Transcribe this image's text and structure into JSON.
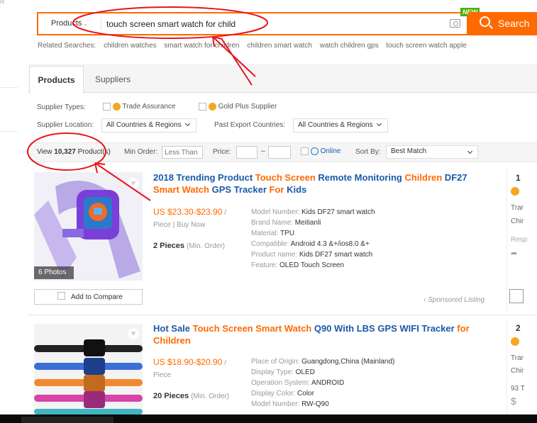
{
  "top_fragment": "rc",
  "search": {
    "category": "Products",
    "query": "touch screen smart watch for child",
    "button_label": "Search",
    "new_badge": "NEW"
  },
  "related": {
    "label": "Related Searches:",
    "items": [
      "children watches",
      "smart watch for children",
      "children smart watch",
      "watch children gps",
      "touch screen watch apple"
    ]
  },
  "tabs": [
    "Products",
    "Suppliers"
  ],
  "filters": {
    "supplier_types_label": "Supplier Types:",
    "trade_assurance": "Trade Assurance",
    "gold_plus": "Gold Plus Supplier",
    "supplier_location_label": "Supplier Location:",
    "supplier_location_value": "All Countries & Regions",
    "past_export_label": "Past Export Countries:",
    "past_export_value": "All Countries & Regions"
  },
  "results_bar": {
    "view_prefix": "View",
    "count": "10,327",
    "view_suffix": "Product(s)",
    "min_order_label": "Min Order:",
    "min_order_placeholder": "Less Than",
    "price_label": "Price:",
    "price_dash": "–",
    "online_label": "Online",
    "sort_label": "Sort By:",
    "sort_value": "Best Match"
  },
  "products": [
    {
      "title_parts": [
        {
          "t": "2018 Trending Product ",
          "hl": false
        },
        {
          "t": "Touch Screen",
          "hl": true
        },
        {
          "t": " Remote Monitoring ",
          "hl": false
        },
        {
          "t": "Children",
          "hl": true
        },
        {
          "t": " DF27 ",
          "hl": false
        },
        {
          "t": "Smart Watch",
          "hl": true
        },
        {
          "t": " GPS Tracker ",
          "hl": false
        },
        {
          "t": "For",
          "hl": true
        },
        {
          "t": " Kids",
          "hl": false
        }
      ],
      "price": "US $23.30-$23.90",
      "price_suffix": " /",
      "unit": "Piece | Buy Now",
      "moq": "2 Pieces",
      "moq_suffix": "(Min. Order)",
      "photos": "6 Photos",
      "compare": "Add to Compare",
      "sponsored": "Sponsored Listing",
      "attrs": [
        {
          "k": "Model Number: ",
          "v": "Kids DF27 smart watch"
        },
        {
          "k": "Brand Name: ",
          "v": "Meitianli"
        },
        {
          "k": "Material: ",
          "v": "TPU"
        },
        {
          "k": "Compatible: ",
          "v": "Android 4.3 &+/ios8.0 &+"
        },
        {
          "k": "Product name: ",
          "v": "Kids DF27 smart watch"
        },
        {
          "k": "Feature: ",
          "v": "OLED Touch Screen"
        }
      ],
      "side": [
        "1",
        "Trar",
        "Chir",
        "Resp"
      ]
    },
    {
      "title_parts": [
        {
          "t": "Hot Sale ",
          "hl": false
        },
        {
          "t": "Touch Screen",
          "hl": true
        },
        {
          "t": " ",
          "hl": false
        },
        {
          "t": "Smart Watch",
          "hl": true
        },
        {
          "t": " Q90 With LBS GPS WIFI Tracker ",
          "hl": false
        },
        {
          "t": "for",
          "hl": true
        },
        {
          "t": " ",
          "hl": false
        },
        {
          "t": "Children",
          "hl": true
        }
      ],
      "price": "US $18.90-$20.90",
      "price_suffix": " /",
      "unit": "Piece",
      "moq": "20 Pieces",
      "moq_suffix": "(Min. Order)",
      "attrs": [
        {
          "k": "Place of Origin: ",
          "v": "Guangdong,China (Mainland)"
        },
        {
          "k": "Display Type: ",
          "v": "OLED"
        },
        {
          "k": "Operation System: ",
          "v": "ANDROID"
        },
        {
          "k": "Display Color: ",
          "v": "Color"
        },
        {
          "k": "Model Number: ",
          "v": "RW-Q90"
        }
      ],
      "side": [
        "2",
        "Trar",
        "Chir",
        "93 T",
        "$"
      ]
    }
  ],
  "colors": {
    "accent": "#ff6a00",
    "link": "#1a5aa8",
    "annotation": "#e8141c",
    "new_badge": "#4cae00"
  }
}
